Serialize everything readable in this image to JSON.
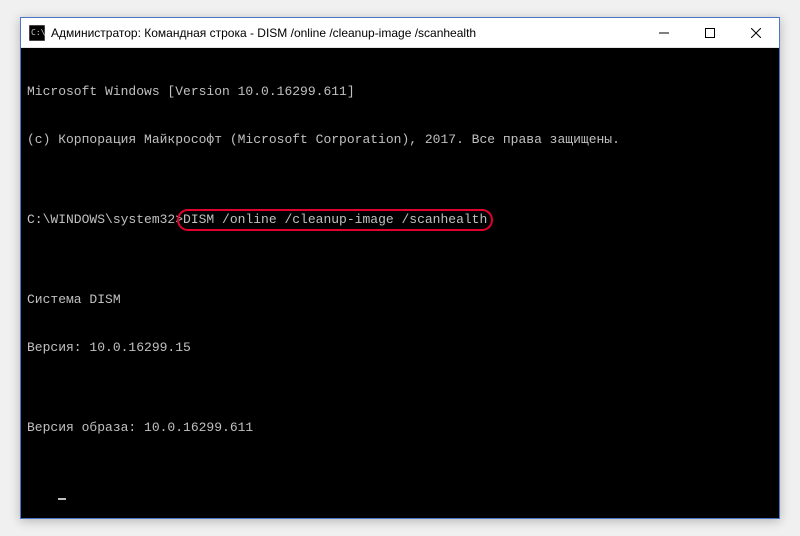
{
  "window": {
    "title": "Администратор: Командная строка - DISM  /online /cleanup-image /scanhealth"
  },
  "console": {
    "header1": "Microsoft Windows [Version 10.0.16299.611]",
    "header2": "(c) Корпорация Майкрософт (Microsoft Corporation), 2017. Все права защищены.",
    "blank": "",
    "prompt": "C:\\WINDOWS\\system32>",
    "command": "DISM /online /cleanup-image /scanhealth",
    "tool_title": "Cистема DISM",
    "tool_version": "Версия: 10.0.16299.15",
    "image_version": "Версия образа: 10.0.16299.611"
  }
}
